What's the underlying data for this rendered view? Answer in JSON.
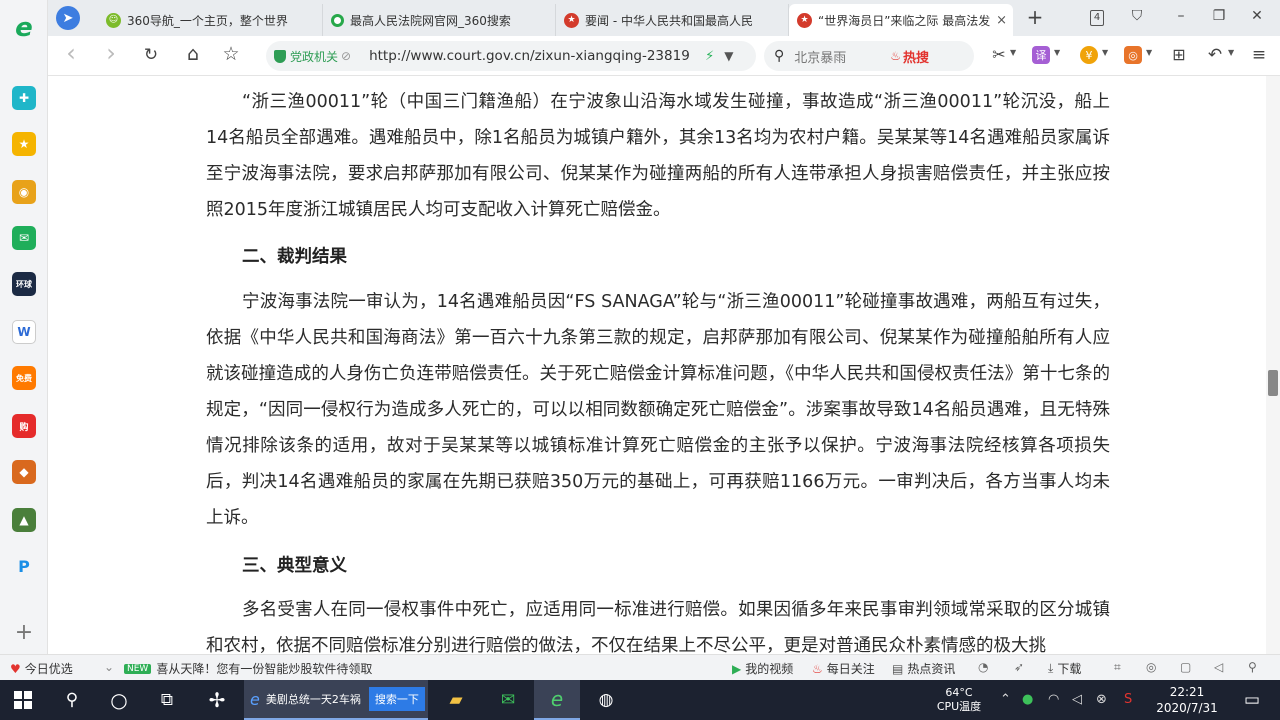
{
  "colors": {
    "accent": "#3d7de0",
    "brand_green": "#1aa95b",
    "hot_red": "#e2342f",
    "taskbar": "#1c2230"
  },
  "sidebar": {
    "items": [
      {
        "name": "logo-icon",
        "glyph": "e"
      },
      {
        "name": "bookmark-icon",
        "glyph": "✚"
      },
      {
        "name": "favorites-star-icon",
        "glyph": "★"
      },
      {
        "name": "weibo-icon",
        "glyph": "◉"
      },
      {
        "name": "mail-icon",
        "glyph": "✉"
      },
      {
        "name": "news-icon",
        "glyph": "环球"
      },
      {
        "name": "document-icon",
        "glyph": "W"
      },
      {
        "name": "novel-icon",
        "glyph": "免费"
      },
      {
        "name": "shopping-icon",
        "glyph": "购"
      },
      {
        "name": "game-icon",
        "glyph": "◆"
      },
      {
        "name": "game2-icon",
        "glyph": "▲"
      },
      {
        "name": "app-icon",
        "glyph": "P"
      },
      {
        "name": "add-icon",
        "glyph": "+"
      }
    ]
  },
  "tabs": [
    {
      "label": "360导航_一个主页，整个世界",
      "active": false
    },
    {
      "label": "最高人民法院网官网_360搜索",
      "active": false
    },
    {
      "label": "要闻 - 中华人民共和国最高人民",
      "active": false
    },
    {
      "label": "“世界海员日”来临之际 最高法发",
      "active": true
    }
  ],
  "tabbar": {
    "tab_count": "4",
    "new_tab": "+",
    "minimize": "–",
    "restore": "❐",
    "close": "✕",
    "shirt": "⛉",
    "close_tab": "×"
  },
  "toolbar": {
    "back": "‹",
    "forward": "›",
    "reload": "↻",
    "home": "⌂",
    "star": "☆",
    "badge": "党政机关",
    "url": "http://www.court.gov.cn/zixun-xiangqing-23819",
    "search_placeholder": "北京暴雨",
    "hot_label": "热搜"
  },
  "article": {
    "para1": "“浙三渔00011”轮（中国三门籍渔船）在宁波象山沿海水域发生碰撞，事故造成“浙三渔00011”轮沉没，船上14名船员全部遇难。遇难船员中，除1名船员为城镇户籍外，其余13名均为农村户籍。吴某某等14名遇难船员家属诉至宁波海事法院，要求启邦萨那加有限公司、倪某某作为碰撞两船的所有人连带承担人身损害赔偿责任，并主张应按照2015年度浙江城镇居民人均可支配收入计算死亡赔偿金。",
    "heading2": "二、裁判结果",
    "para2": "宁波海事法院一审认为，14名遇难船员因“FS SANAGA”轮与“浙三渔00011”轮碰撞事故遇难，两船互有过失，依据《中华人民共和国海商法》第一百六十九条第三款的规定，启邦萨那加有限公司、倪某某作为碰撞船舶所有人应就该碰撞造成的人身伤亡负连带赔偿责任。关于死亡赔偿金计算标准问题，《中华人民共和国侵权责任法》第十七条的规定，“因同一侵权行为造成多人死亡的，可以以相同数额确定死亡赔偿金”。涉案事故导致14名船员遇难，且无特殊情况排除该条的适用，故对于吴某某等以城镇标准计算死亡赔偿金的主张予以保护。宁波海事法院经核算各项损失后，判决14名遇难船员的家属在先期已获赔350万元的基础上，可再获赔1166万元。一审判决后，各方当事人均未上诉。",
    "heading3": "三、典型意义",
    "para3": "多名受害人在同一侵权事件中死亡，应适用同一标准进行赔偿。如果因循多年来民事审判领域常采取的区分城镇和农村，依据不同赔偿标准分别进行赔偿的做法，不仅在结果上不尽公平，更是对普通民众朴素情感的极大挑"
  },
  "statusbar": {
    "today": "今日优选",
    "new_badge": "NEW",
    "promo": "喜从天降！您有一份智能炒股软件待领取",
    "video": "我的视频",
    "daily": "每日关注",
    "hotnews": "热点资讯",
    "download": "下载"
  },
  "taskbar": {
    "ie_label": "美剧总统一天2车祸",
    "ie_button": "搜索一下",
    "temp": "64°C",
    "cpu": "CPU温度",
    "time": "22:21",
    "date": "2020/7/31"
  }
}
